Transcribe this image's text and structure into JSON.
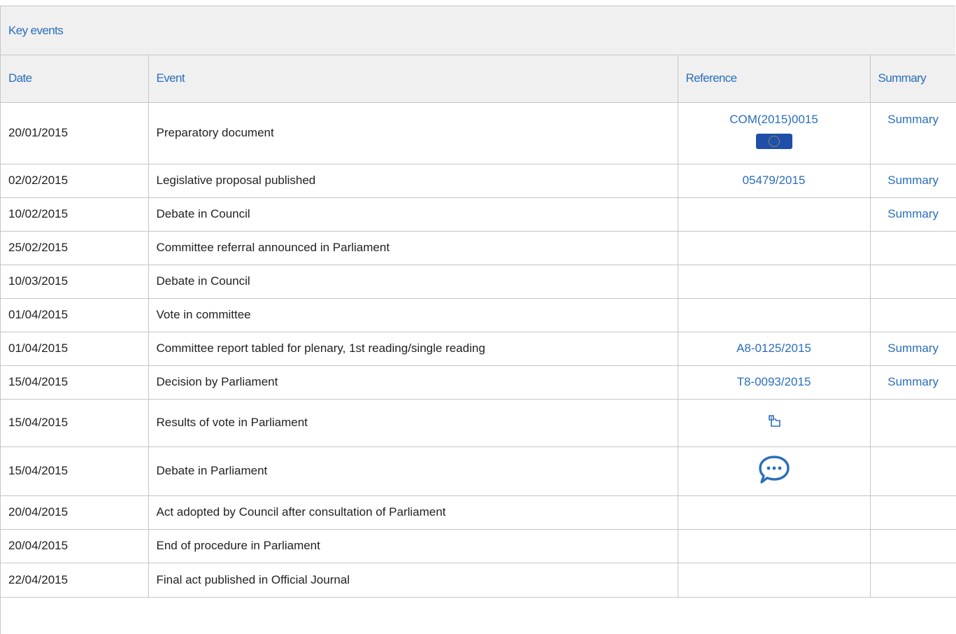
{
  "panel": {
    "title": "Key events"
  },
  "table": {
    "headers": {
      "date": "Date",
      "event": "Event",
      "reference": "Reference",
      "summary": "Summary"
    },
    "rows": [
      {
        "date": "20/01/2015",
        "event": "Preparatory document",
        "reference": "COM(2015)0015",
        "reference_icon": "eu-flag-icon",
        "summary": "Summary"
      },
      {
        "date": "02/02/2015",
        "event": "Legislative proposal published",
        "reference": "05479/2015",
        "summary": "Summary"
      },
      {
        "date": "10/02/2015",
        "event": "Debate in Council",
        "reference": "",
        "summary": "Summary"
      },
      {
        "date": "25/02/2015",
        "event": "Committee referral announced in Parliament",
        "reference": "",
        "summary": ""
      },
      {
        "date": "10/03/2015",
        "event": "Debate in Council",
        "reference": "",
        "summary": ""
      },
      {
        "date": "01/04/2015",
        "event": "Vote in committee",
        "reference": "",
        "summary": ""
      },
      {
        "date": "01/04/2015",
        "event": "Committee report tabled for plenary, 1st reading/single reading",
        "reference": "A8-0125/2015",
        "summary": "Summary"
      },
      {
        "date": "15/04/2015",
        "event": "Decision by Parliament",
        "reference": "T8-0093/2015",
        "summary": "Summary"
      },
      {
        "date": "15/04/2015",
        "event": "Results of vote in Parliament",
        "reference_icon": "vote-results-icon",
        "summary": ""
      },
      {
        "date": "15/04/2015",
        "event": "Debate in Parliament",
        "reference_icon": "debate-speech-bubble-icon",
        "summary": ""
      },
      {
        "date": "20/04/2015",
        "event": "Act adopted by Council after consultation of Parliament",
        "reference": "",
        "summary": ""
      },
      {
        "date": "20/04/2015",
        "event": "End of procedure in Parliament",
        "reference": "",
        "summary": ""
      },
      {
        "date": "22/04/2015",
        "event": "Final act published in Official Journal",
        "reference": "",
        "summary": ""
      }
    ]
  },
  "colors": {
    "link": "#2a6ebb",
    "header_bg": "#f0f0f0",
    "border": "#c6c6c6",
    "text": "#222222"
  }
}
